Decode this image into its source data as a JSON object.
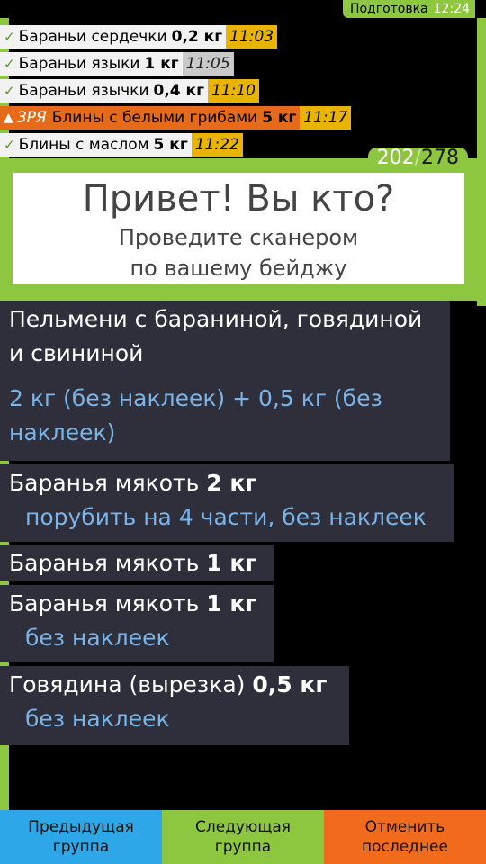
{
  "status": {
    "label": "Подготовка",
    "time": "12:24"
  },
  "done_items": [
    {
      "name": "Бараньи сердечки",
      "qty": "0,2 кг",
      "time": "11:03",
      "time_style": "gold"
    },
    {
      "name": "Бараньи языки",
      "qty": "1 кг",
      "time": "11:05",
      "time_style": "silver"
    },
    {
      "name": "Бараньи язычки",
      "qty": "0,4 кг",
      "time": "11:10",
      "time_style": "gold"
    },
    {
      "prefix": "ЗРЯ",
      "name": "Блины с белыми грибами",
      "qty": "5 кг",
      "time": "11:17",
      "time_style": "gold",
      "alert": true
    },
    {
      "name": "Блины с маслом",
      "qty": "5 кг",
      "time": "11:22",
      "time_style": "gold"
    }
  ],
  "counter": {
    "done": "202",
    "separator": "/",
    "total": "278"
  },
  "greeting": {
    "title": "Привет! Вы кто?",
    "line1": "Проведите сканером",
    "line2": "по вашему бейджу"
  },
  "tasks": [
    {
      "name_line1": "Пельмени с бараниной, говядиной",
      "name_line2": "и свининой",
      "note_line1": "2 кг (без наклеек) + 0,5 кг (без",
      "note_line2": "наклеек)"
    },
    {
      "name": "Баранья мякоть",
      "qty": "2 кг",
      "note": "порубить на 4 части, без наклеек"
    },
    {
      "name": "Баранья мякоть",
      "qty": "1 кг"
    },
    {
      "name": "Баранья мякоть",
      "qty": "1 кг",
      "note": "без наклеек"
    },
    {
      "name": "Говядина (вырезка)",
      "qty": "0,5 кг",
      "note": "без наклеек"
    }
  ],
  "buttons": {
    "prev": {
      "line1": "Предыдущая",
      "line2": "группа",
      "color": "#2ea7e8"
    },
    "next": {
      "line1": "Следующая",
      "line2": "группа",
      "color": "#8dc63f"
    },
    "undo": {
      "line1": "Отменить",
      "line2": "последнее",
      "color": "#f26b1d"
    }
  },
  "icons": {
    "check": "check-icon",
    "warning": "warning-icon"
  }
}
